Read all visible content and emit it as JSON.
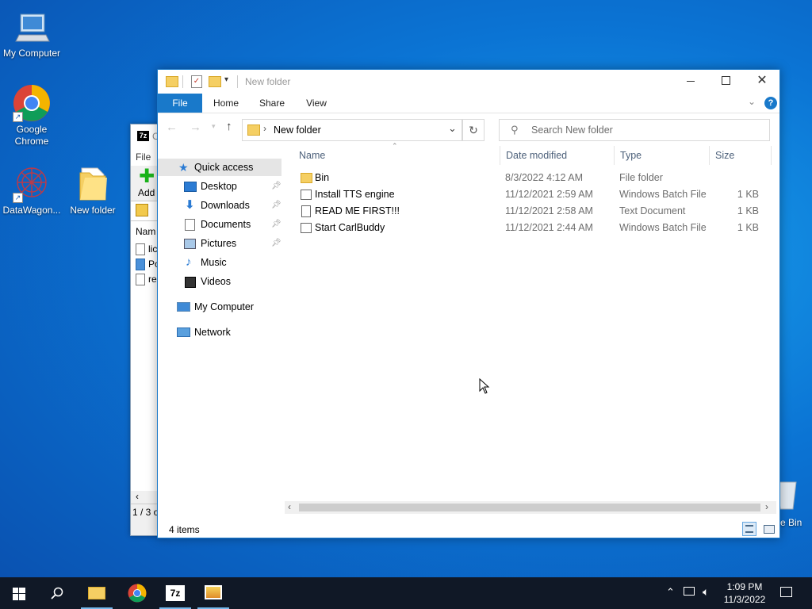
{
  "desktop": {
    "icons": [
      {
        "label": "My Computer",
        "icon": "computer-icon"
      },
      {
        "label": "Google Chrome",
        "icon": "chrome-icon"
      },
      {
        "label": "DataWagon...",
        "icon": "datawagon-icon"
      },
      {
        "label": "New folder",
        "icon": "folder-icon"
      },
      {
        "label": "e Bin",
        "icon": "recycle-bin-icon"
      }
    ]
  },
  "zip_window": {
    "title_fragment": "C",
    "menu_fragment": "File",
    "add_label": "Add",
    "column_fragment": "Nam",
    "rows": [
      "lic",
      "Po",
      "re"
    ],
    "status_fragment": "1 / 3 o"
  },
  "explorer": {
    "title": "New folder",
    "tabs": [
      "File",
      "Home",
      "Share",
      "View"
    ],
    "address": "New folder",
    "search_placeholder": "Search New folder",
    "nav": [
      {
        "label": "Quick access",
        "icon": "star-icon",
        "pinned": false
      },
      {
        "label": "Desktop",
        "icon": "desktop-icon",
        "pinned": true
      },
      {
        "label": "Downloads",
        "icon": "download-icon",
        "pinned": true
      },
      {
        "label": "Documents",
        "icon": "documents-icon",
        "pinned": true
      },
      {
        "label": "Pictures",
        "icon": "pictures-icon",
        "pinned": true
      },
      {
        "label": "Music",
        "icon": "music-icon",
        "pinned": false
      },
      {
        "label": "Videos",
        "icon": "videos-icon",
        "pinned": false
      },
      {
        "label": "My Computer",
        "icon": "computer-icon",
        "pinned": false
      },
      {
        "label": "Network",
        "icon": "network-icon",
        "pinned": false
      }
    ],
    "columns": [
      "Name",
      "Date modified",
      "Type",
      "Size"
    ],
    "files": [
      {
        "name": "Bin",
        "date": "8/3/2022 4:12 AM",
        "type": "File folder",
        "size": "",
        "icon": "folder-icon"
      },
      {
        "name": "Install TTS engine",
        "date": "11/12/2021 2:59 AM",
        "type": "Windows Batch File",
        "size": "1 KB",
        "icon": "batch-file-icon"
      },
      {
        "name": "READ ME FIRST!!!",
        "date": "11/12/2021 2:58 AM",
        "type": "Text Document",
        "size": "1 KB",
        "icon": "text-file-icon"
      },
      {
        "name": "Start CarlBuddy",
        "date": "11/12/2021 2:44 AM",
        "type": "Windows Batch File",
        "size": "1 KB",
        "icon": "batch-file-icon"
      }
    ],
    "status": "4 items"
  },
  "taskbar": {
    "time": "1:09 PM",
    "date": "11/3/2022",
    "apps": [
      "file-explorer-icon",
      "chrome-icon",
      "7zip-icon",
      "photos-icon"
    ]
  },
  "colors": {
    "accent": "#1979ca",
    "taskbar": "#101826",
    "selected_nav": "#e5e5e5"
  }
}
